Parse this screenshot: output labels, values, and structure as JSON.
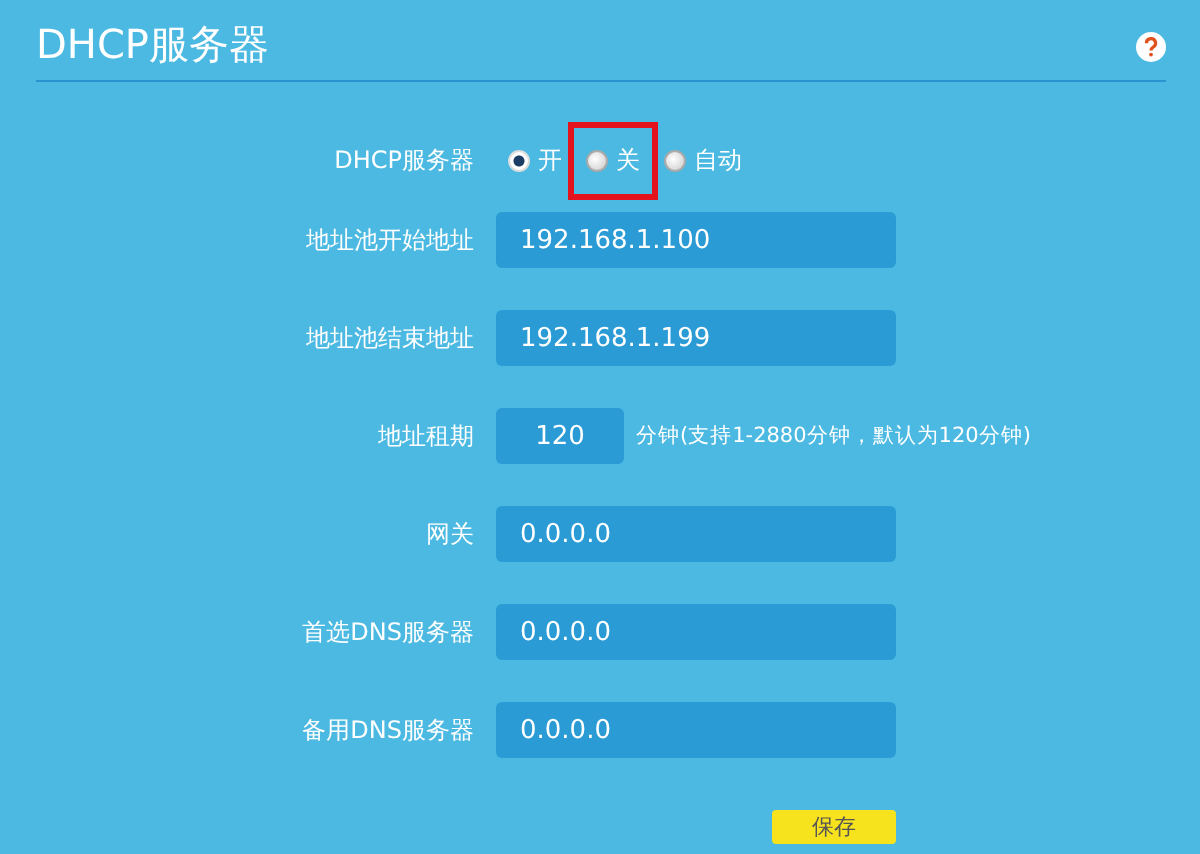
{
  "title": "DHCP服务器",
  "dhcp_server": {
    "label": "DHCP服务器",
    "options": [
      {
        "label": "开",
        "selected": true,
        "highlighted": false
      },
      {
        "label": "关",
        "selected": false,
        "highlighted": true
      },
      {
        "label": "自动",
        "selected": false,
        "highlighted": false
      }
    ]
  },
  "fields": [
    {
      "kind": "wide",
      "label": "地址池开始地址",
      "value": "192.168.1.100"
    },
    {
      "kind": "wide",
      "label": "地址池结束地址",
      "value": "192.168.1.199"
    },
    {
      "kind": "short",
      "label": "地址租期",
      "value": "120",
      "hint": "分钟(支持1-2880分钟，默认为120分钟)"
    },
    {
      "kind": "wide",
      "label": "网关",
      "value": "0.0.0.0"
    },
    {
      "kind": "wide",
      "label": "首选DNS服务器",
      "value": "0.0.0.0"
    },
    {
      "kind": "wide",
      "label": "备用DNS服务器",
      "value": "0.0.0.0"
    }
  ],
  "save_button": "保存"
}
